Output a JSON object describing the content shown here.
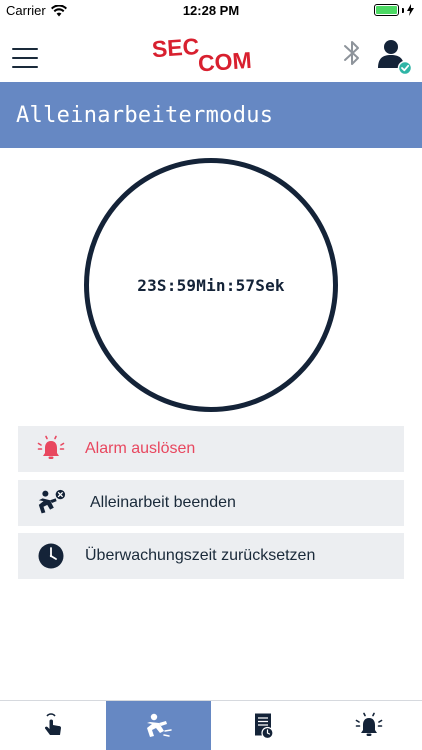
{
  "status_bar": {
    "carrier": "Carrier",
    "time": "12:28 PM",
    "battery_level": 1.0
  },
  "header": {
    "logo_text": [
      "SEC",
      "COM"
    ],
    "icons": [
      "menu-icon",
      "bluetooth-icon",
      "user-verified-icon"
    ]
  },
  "page": {
    "title": "Alleinarbeitermodus"
  },
  "timer": {
    "value": "23S:59Min:57Sek"
  },
  "actions": {
    "alarm": {
      "label": "Alarm auslösen",
      "icon": "alarm-bell-icon",
      "color": "#e8475f"
    },
    "end": {
      "label": "Alleinarbeit beenden",
      "icon": "falling-person-icon"
    },
    "reset": {
      "label": "Überwachungszeit zurücksetzen",
      "icon": "clock-icon"
    }
  },
  "tabs": [
    {
      "icon": "tap-hand-icon",
      "active": false
    },
    {
      "icon": "falling-person-icon",
      "active": true
    },
    {
      "icon": "document-clock-icon",
      "active": false
    },
    {
      "icon": "alarm-bell-icon",
      "active": false
    }
  ],
  "colors": {
    "accent": "#6688c3",
    "dark": "#142338",
    "alarm": "#e8475f",
    "logo_red": "#d8202f",
    "verified": "#2fb5a6"
  }
}
